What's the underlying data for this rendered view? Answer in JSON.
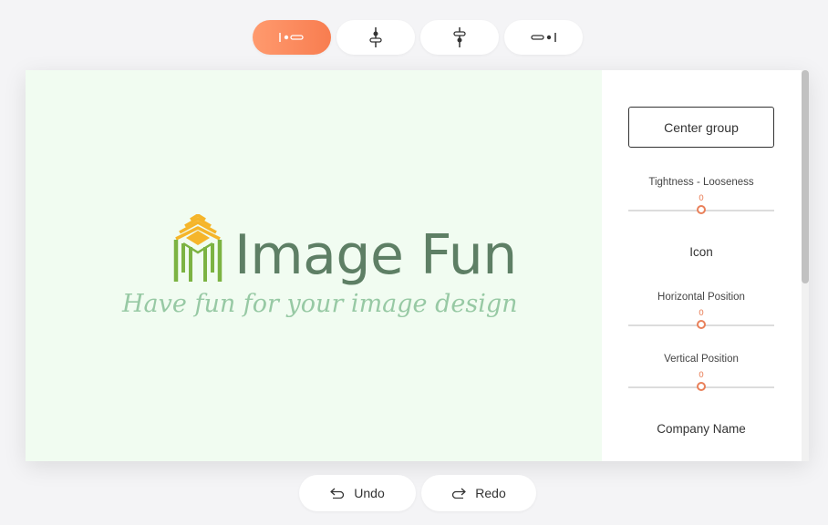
{
  "layout_buttons": [
    {
      "icon": "align-left-layout-icon",
      "active": true
    },
    {
      "icon": "align-top-layout-icon",
      "active": false
    },
    {
      "icon": "align-bottom-layout-icon",
      "active": false
    },
    {
      "icon": "align-right-layout-icon",
      "active": false
    }
  ],
  "canvas": {
    "background": "#f1fcf1",
    "brand_name": "Image Fun",
    "tagline": "Have fun for your image design",
    "brand_color": "#5e7f65",
    "tagline_color": "#97c9a4",
    "icon": "logo-icon"
  },
  "side_panel": {
    "center_group_label": "Center group",
    "tightness": {
      "label": "Tightness - Looseness",
      "value": "0"
    },
    "icon_section": "Icon",
    "horizontal": {
      "label": "Horizontal Position",
      "value": "0"
    },
    "vertical": {
      "label": "Vertical Position",
      "value": "0"
    },
    "company_section": "Company Name",
    "accent": "#e9805a"
  },
  "history": {
    "undo_label": "Undo",
    "redo_label": "Redo"
  }
}
